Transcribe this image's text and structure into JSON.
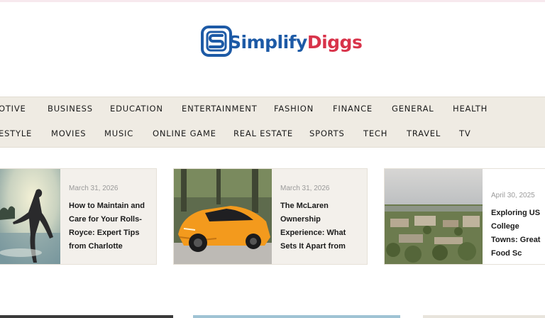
{
  "site": {
    "logo_text_part1": "Simplify",
    "logo_text_part2": "Diggs",
    "brand_blue": "#1d5aa6",
    "brand_red": "#d8334a"
  },
  "nav": {
    "row1": [
      "OTIVE",
      "BUSINESS",
      "EDUCATION",
      "ENTERTAINMENT",
      "FASHION",
      "FINANCE",
      "GENERAL",
      "HEALTH"
    ],
    "row2": [
      "ESTYLE",
      "MOVIES",
      "MUSIC",
      "ONLINE GAME",
      "REAL ESTATE",
      "SPORTS",
      "TECH",
      "TRAVEL",
      "TV"
    ]
  },
  "posts": [
    {
      "date": "March 31, 2026",
      "title": "How to Maintain and Care for Your Rolls-Royce: Expert Tips from Charlotte",
      "image": "silhouette-dancer-photo"
    },
    {
      "date": "March 31, 2026",
      "title": "The McLaren Ownership Experience: What Sets It Apart from",
      "image": "orange-sports-car-photo"
    },
    {
      "date": "April 30, 2025",
      "title": "Exploring US College Towns: Great Food Sc",
      "image": "college-town-aerial-photo"
    }
  ],
  "colors": {
    "nav_background": "#efebe3",
    "card_background": "#f3f0eb"
  }
}
